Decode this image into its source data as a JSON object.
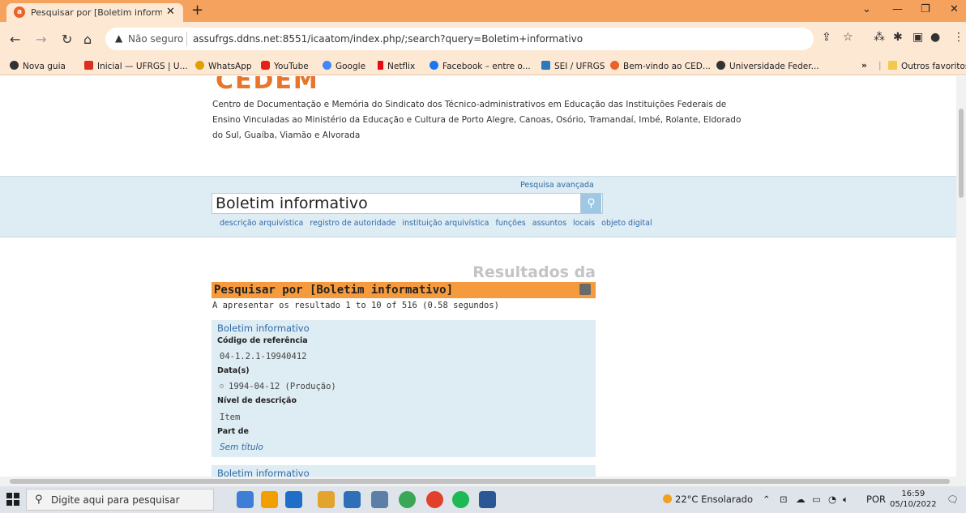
{
  "browser": {
    "tab_title": "Pesquisar por [Boletim informati",
    "address_warning": "Não seguro",
    "url": "assufrgs.ddns.net:8551/icaatom/index.php/;search?query=Boletim+informativo",
    "bookmarks": [
      "Nova guia",
      "Inicial — UFRGS | U...",
      "WhatsApp",
      "YouTube",
      "Google",
      "Netflix",
      "Facebook – entre o...",
      "SEI / UFRGS",
      "Bem-vindo ao CED...",
      "Universidade Feder..."
    ],
    "other_bookmarks": "Outros favoritos"
  },
  "site": {
    "logo": "CEDEM",
    "description": "Centro de Documentação e Memória do Sindicato dos Técnico-administrativos em Educação das Instituições Federais de Ensino Vinculadas ao Ministério da Educação e Cultura de Porto Alegre, Canoas, Osório, Tramandaí, Imbé, Rolante, Eldorado do Sul, Guaíba, Viamão e Alvorada"
  },
  "search": {
    "advanced_link": "Pesquisa avançada",
    "query": "Boletim informativo",
    "entity_links": [
      "descrição arquivística",
      "registro de autoridade",
      "instituição arquivística",
      "funções",
      "assuntos",
      "locais",
      "objeto digital"
    ]
  },
  "results": {
    "heading": "Resultados da pesquisa",
    "query_label": "Pesquisar por [Boletim informativo]",
    "count_text": "A apresentar os resultado 1 to 10 of 516 (0.58 segundos)",
    "items": [
      {
        "title": "Boletim informativo",
        "ref_label": "Código de referência",
        "ref_value": "04-1.2.1-19940412",
        "date_label": "Data(s)",
        "date_value": "1994-04-12 (Produção)",
        "level_label": "Nível de descrição",
        "level_value": "Item",
        "part_label": "Part de",
        "part_value": "Sem título"
      },
      {
        "title": "Boletim informativo"
      }
    ]
  },
  "taskbar": {
    "search_placeholder": "Digite aqui para pesquisar",
    "weather": "22°C Ensolarado",
    "language": "POR",
    "time": "16:59",
    "date": "05/10/2022"
  }
}
